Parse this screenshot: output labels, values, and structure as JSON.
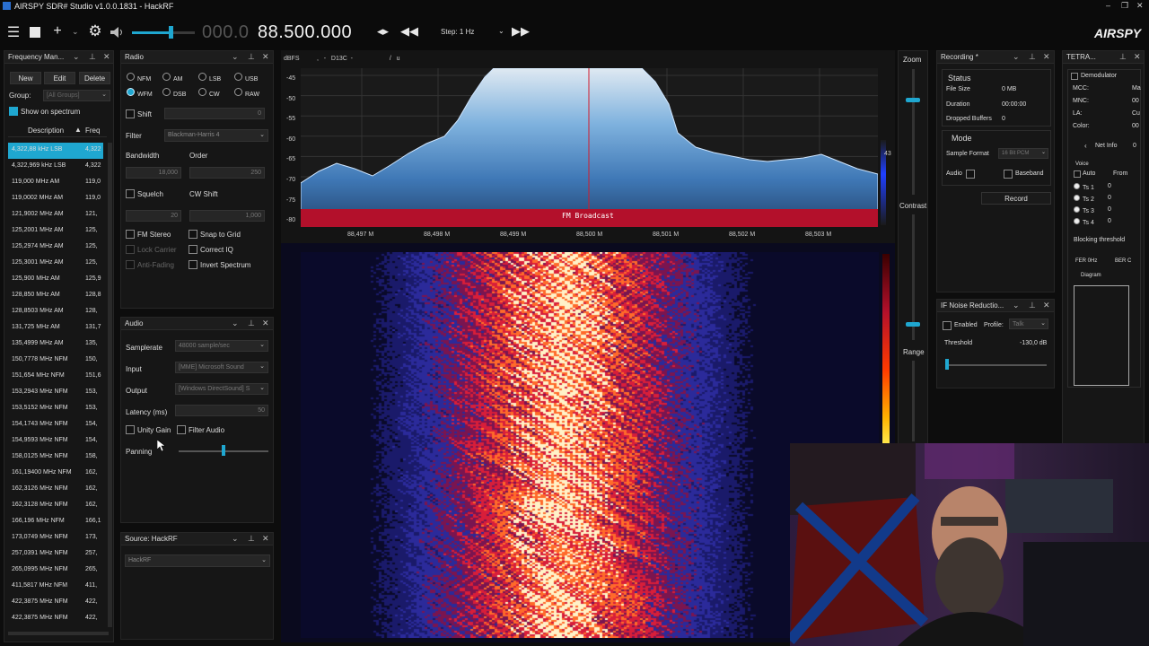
{
  "window": {
    "title": "AIRSPY SDR# Studio v1.0.0.1831 - HackRF",
    "controls": [
      "–",
      "❐",
      "✕"
    ]
  },
  "toolbar": {
    "frequency_dim": "000.0",
    "frequency_main": "88.500.000",
    "step_label": "Step: 1 Hz",
    "logo": "AIRSPY",
    "volume_level": 0.62
  },
  "freq_manager": {
    "title": "Frequency Man...",
    "buttons": [
      "New",
      "Edit",
      "Delete"
    ],
    "group_label": "Group:",
    "group_value": "[All Groups]",
    "show_on_spectrum": "Show on spectrum",
    "col_description": "Description",
    "col_freq": "Freq",
    "rows": [
      {
        "desc": "4,322,88 kHz LSB",
        "freq": "4,322",
        "selected": true
      },
      {
        "desc": "4,322,969 kHz LSB",
        "freq": "4,322"
      },
      {
        "desc": "119,000 MHz AM",
        "freq": "119,0"
      },
      {
        "desc": "119,0002 MHz AM",
        "freq": "119,0"
      },
      {
        "desc": "121,9002 MHz AM",
        "freq": "121,"
      },
      {
        "desc": "125,2001 MHz AM",
        "freq": "125,"
      },
      {
        "desc": "125,2974 MHz AM",
        "freq": "125,"
      },
      {
        "desc": "125,3001 MHz AM",
        "freq": "125,"
      },
      {
        "desc": "125,900 MHz AM",
        "freq": "125,9"
      },
      {
        "desc": "128,850 MHz AM",
        "freq": "128,8"
      },
      {
        "desc": "128,8503 MHz AM",
        "freq": "128,"
      },
      {
        "desc": "131,725 MHz AM",
        "freq": "131,7"
      },
      {
        "desc": "135,4999 MHz AM",
        "freq": "135,"
      },
      {
        "desc": "150,7778 MHz NFM",
        "freq": "150,"
      },
      {
        "desc": "151,654 MHz NFM",
        "freq": "151,6"
      },
      {
        "desc": "153,2943 MHz NFM",
        "freq": "153,"
      },
      {
        "desc": "153,5152 MHz NFM",
        "freq": "153,"
      },
      {
        "desc": "154,1743 MHz NFM",
        "freq": "154,"
      },
      {
        "desc": "154,9593 MHz NFM",
        "freq": "154,"
      },
      {
        "desc": "158,0125 MHz NFM",
        "freq": "158,"
      },
      {
        "desc": "161,19400 MHz NFM",
        "freq": "162,"
      },
      {
        "desc": "162,3126 MHz NFM",
        "freq": "162,"
      },
      {
        "desc": "162,3128 MHz NFM",
        "freq": "162,"
      },
      {
        "desc": "166,196 MHz NFM",
        "freq": "166,1"
      },
      {
        "desc": "173,0749 MHz NFM",
        "freq": "173,"
      },
      {
        "desc": "257,0391 MHz NFM",
        "freq": "257,"
      },
      {
        "desc": "265,0995 MHz NFM",
        "freq": "265,"
      },
      {
        "desc": "411,5817 MHz NFM",
        "freq": "411,"
      },
      {
        "desc": "422,3875 MHz NFM",
        "freq": "422,"
      },
      {
        "desc": "422,3875 MHz NFM",
        "freq": "422,"
      }
    ]
  },
  "radio": {
    "title": "Radio",
    "modes": [
      {
        "label": "NFM",
        "on": false
      },
      {
        "label": "AM",
        "on": false
      },
      {
        "label": "LSB",
        "on": false
      },
      {
        "label": "USB",
        "on": false
      },
      {
        "label": "WFM",
        "on": true
      },
      {
        "label": "DSB",
        "on": false
      },
      {
        "label": "CW",
        "on": false
      },
      {
        "label": "RAW",
        "on": false
      }
    ],
    "shift": "Shift",
    "shift_value": "0",
    "filter_label": "Filter",
    "filter_value": "Blackman-Harris 4",
    "bandwidth_label": "Bandwidth",
    "bandwidth_value": "18,000",
    "order_label": "Order",
    "order_value": "250",
    "squelch": "Squelch",
    "squelch_value": "20",
    "cw_shift": "CW Shift",
    "cw_shift_value": "1,000",
    "fm_stereo": "FM Stereo",
    "snap_to_grid": "Snap to Grid",
    "lock_carrier": "Lock Carrier",
    "correct_iq": "Correct IQ",
    "anti_fading": "Anti-Fading",
    "invert_spectrum": "Invert Spectrum"
  },
  "audio": {
    "title": "Audio",
    "samplerate_label": "Samplerate",
    "samplerate_value": "48000 sample/sec",
    "input_label": "Input",
    "input_value": "[MME] Microsoft Sound",
    "output_label": "Output",
    "output_value": "[Windows DirectSound] S",
    "latency_label": "Latency (ms)",
    "latency_value": "50",
    "unity_gain": "Unity Gain",
    "filter_audio": "Filter Audio",
    "panning": "Panning"
  },
  "source": {
    "title": "Source: HackRF",
    "value": "HackRF"
  },
  "spectrum": {
    "header": "dBFS          ,   -   D13C  -                     /   u",
    "y_ticks": [
      "-45",
      "-50",
      "-55",
      "-60",
      "-65",
      "-70",
      "-75",
      "-80"
    ],
    "x_ticks": [
      "88,497 M",
      "88,498 M",
      "88,499 M",
      "88,500 M",
      "88,501 M",
      "88,502 M",
      "88,503 M"
    ],
    "band_label": "FM Broadcast",
    "right_value": "43",
    "zoom": "Zoom",
    "contrast": "Contrast",
    "range": "Range"
  },
  "recording": {
    "title": "Recording *",
    "status": "Status",
    "file_size_label": "File Size",
    "file_size_value": "0 MB",
    "duration_label": "Duration",
    "duration_value": "00:00:00",
    "dropped_label": "Dropped Buffers",
    "dropped_value": "0",
    "mode": "Mode",
    "sample_format_label": "Sample Format",
    "sample_format_value": "16 Bit PCM",
    "audio": "Audio",
    "baseband": "Baseband",
    "record_button": "Record"
  },
  "noise": {
    "title": "IF Noise Reductio...",
    "enabled": "Enabled",
    "profile_label": "Profile:",
    "profile_value": "Talk",
    "threshold_label": "Threshold",
    "threshold_value": "-130,0 dB"
  },
  "tetra": {
    "title": "TETRA...",
    "demodulator": "Demodulator",
    "fields": [
      {
        "label": "MCC:",
        "value": "Ma"
      },
      {
        "label": "MNC:",
        "value": "00"
      },
      {
        "label": "LA:",
        "value": "Cu"
      },
      {
        "label": "Color:",
        "value": "00"
      }
    ],
    "net_info": "Net Info",
    "net_info_value": "0",
    "voice": "Voice",
    "auto": "Auto",
    "from": "From",
    "ts": [
      {
        "label": "Ts 1",
        "value": "0"
      },
      {
        "label": "Ts 2",
        "value": "0"
      },
      {
        "label": "Ts 3",
        "value": "0"
      },
      {
        "label": "Ts 4",
        "value": "0"
      }
    ],
    "blocking": "Blocking threshold",
    "fer": "FER 0Hz",
    "ber": "BER C",
    "diagram": "Diagram"
  },
  "colors": {
    "accent": "#1fa7d0",
    "band": "#b3102b",
    "bg": "#0d0d0d"
  }
}
